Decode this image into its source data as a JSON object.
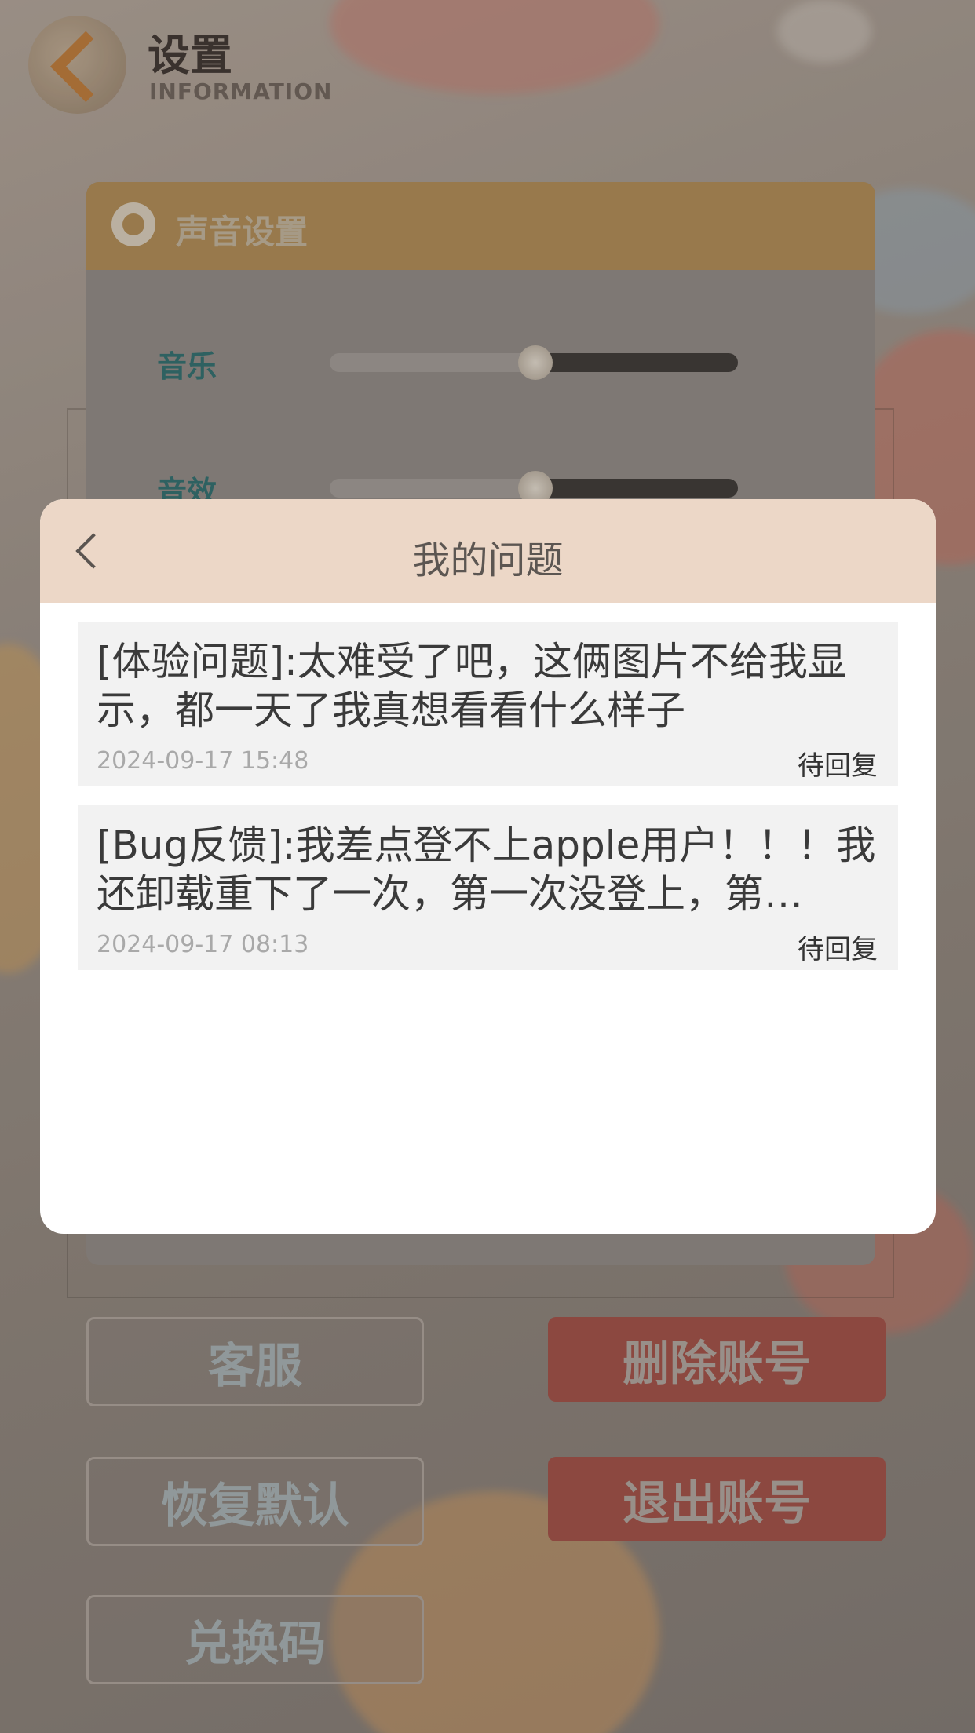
{
  "settings_page": {
    "title": "设置",
    "subtitle": "INFORMATION",
    "section_title": "声音设置",
    "music_label": "音乐",
    "sfx_label": "音效",
    "music_level": 0.5,
    "sfx_level": 0.5,
    "buttons": {
      "customer_service": "客服",
      "delete_account": "删除账号",
      "restore_defaults": "恢复默认",
      "logout": "退出账号",
      "redeem_code": "兑换码"
    }
  },
  "modal": {
    "title": "我的问题",
    "items": [
      {
        "text": "[体验问题]:太难受了吧，这俩图片不给我显示，都一天了我真想看看什么样子",
        "date": "2024-09-17 15:48",
        "status": "待回复"
      },
      {
        "text": "[Bug反馈]:我差点登不上apple用户！！！我还卸载重下了一次，第一次没登上，第…",
        "date": "2024-09-17 08:13",
        "status": "待回复"
      }
    ]
  },
  "colors": {
    "modal_header": "#ecd7c7",
    "item_background": "#f2f2f2",
    "date_text": "#a9a9a9"
  }
}
